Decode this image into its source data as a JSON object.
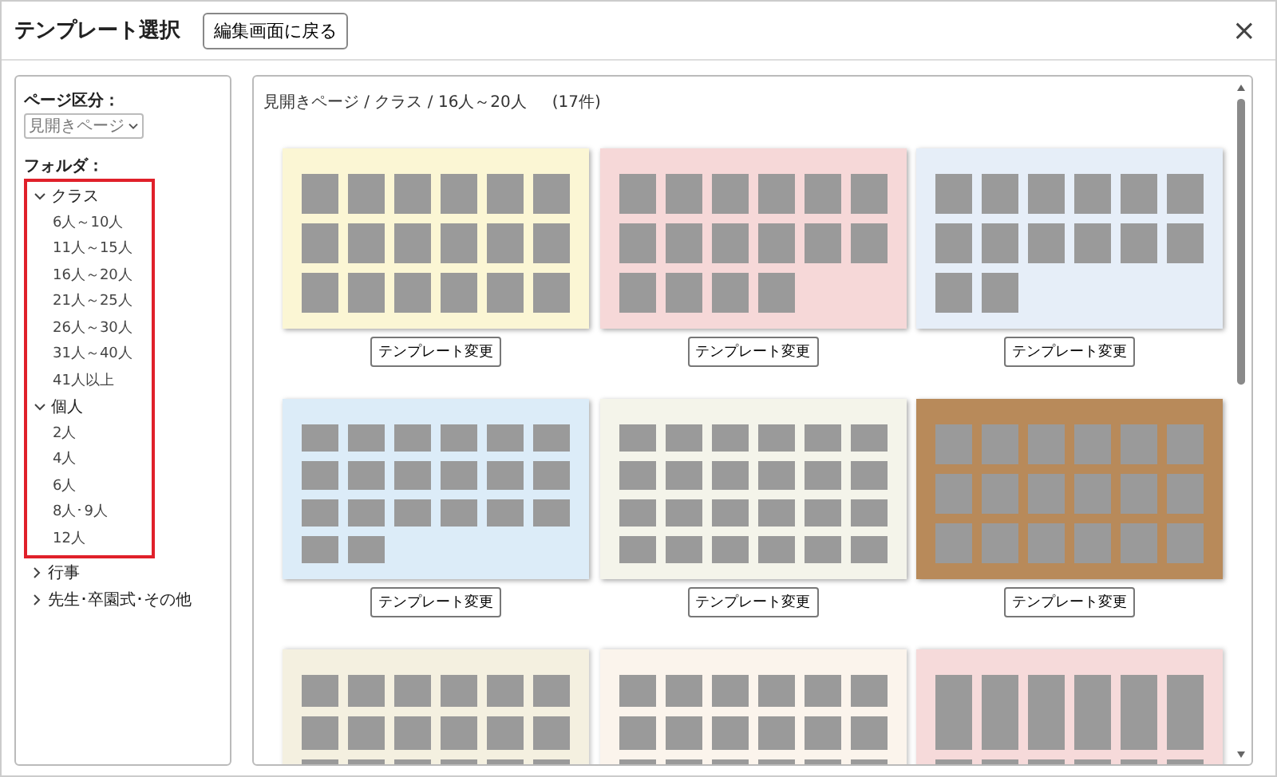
{
  "window": {
    "title": "テンプレート選択",
    "back_button": "編集画面に戻る",
    "close": "×"
  },
  "sidebar": {
    "page_type_label": "ページ区分：",
    "page_type_value": "見開きページ",
    "folder_label": "フォルダ：",
    "folders": [
      {
        "label": "クラス",
        "expanded": true,
        "highlighted": true,
        "children": [
          {
            "label": "6人～10人"
          },
          {
            "label": "11人～15人"
          },
          {
            "label": "16人～20人"
          },
          {
            "label": "21人～25人"
          },
          {
            "label": "26人～30人"
          },
          {
            "label": "31人～40人"
          },
          {
            "label": "41人以上"
          }
        ]
      },
      {
        "label": "個人",
        "expanded": true,
        "highlighted": true,
        "children": [
          {
            "label": "2人"
          },
          {
            "label": "4人"
          },
          {
            "label": "6人"
          },
          {
            "label": "8人･9人"
          },
          {
            "label": "12人"
          }
        ]
      },
      {
        "label": "行事",
        "expanded": false,
        "highlighted": false
      },
      {
        "label": "先生･卒園式･その他",
        "expanded": false,
        "highlighted": false
      }
    ]
  },
  "content": {
    "breadcrumb": "見開きページ / クラス / 16人～20人",
    "count": "(17件)",
    "templates": [
      {
        "button": "テンプレート変更"
      },
      {
        "button": "テンプレート変更"
      },
      {
        "button": "テンプレート変更"
      },
      {
        "button": "テンプレート変更"
      },
      {
        "button": "テンプレート変更"
      },
      {
        "button": "テンプレート変更"
      },
      {
        "kind": "cut"
      },
      {
        "kind": "cut"
      },
      {
        "kind": "cut"
      }
    ]
  }
}
